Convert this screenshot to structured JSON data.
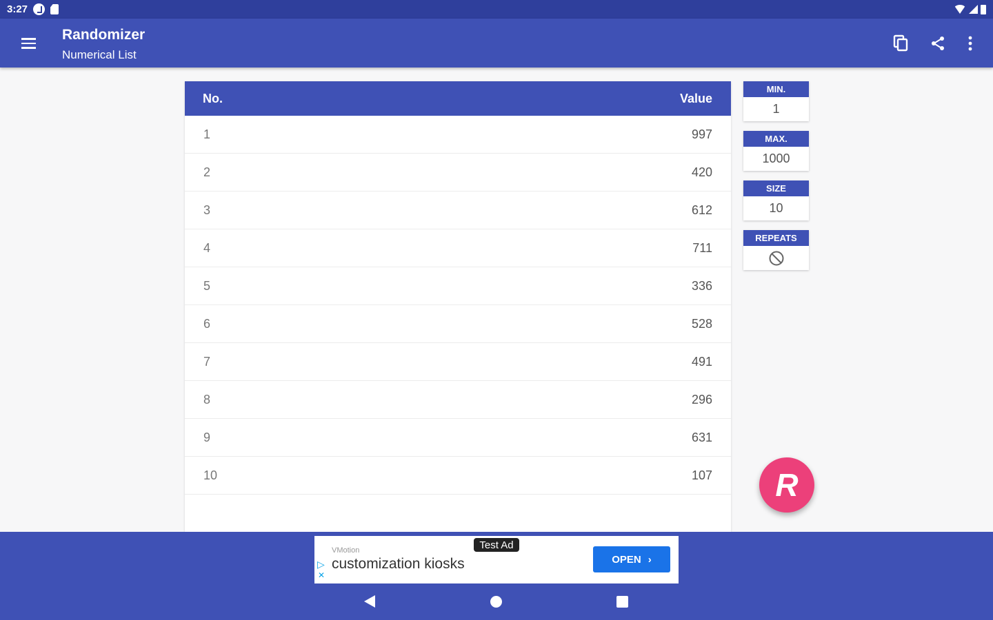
{
  "status_bar": {
    "time": "3:27"
  },
  "app_bar": {
    "title": "Randomizer",
    "subtitle": "Numerical List",
    "actions": [
      "copy-icon",
      "share-icon",
      "more-vert-icon"
    ]
  },
  "table": {
    "header": {
      "no": "No.",
      "value": "Value"
    },
    "rows": [
      {
        "no": "1",
        "value": "997"
      },
      {
        "no": "2",
        "value": "420"
      },
      {
        "no": "3",
        "value": "612"
      },
      {
        "no": "4",
        "value": "711"
      },
      {
        "no": "5",
        "value": "336"
      },
      {
        "no": "6",
        "value": "528"
      },
      {
        "no": "7",
        "value": "491"
      },
      {
        "no": "8",
        "value": "296"
      },
      {
        "no": "9",
        "value": "631"
      },
      {
        "no": "10",
        "value": "107"
      }
    ]
  },
  "settings": {
    "min": {
      "label": "MIN.",
      "value": "1"
    },
    "max": {
      "label": "MAX.",
      "value": "1000"
    },
    "size": {
      "label": "SIZE",
      "value": "10"
    },
    "repeats": {
      "label": "REPEATS",
      "icon": "block-icon"
    }
  },
  "fab": {
    "label": "R"
  },
  "ad": {
    "advertiser": "VMotion",
    "headline": "customization kiosks",
    "badge": "Test Ad",
    "cta": "OPEN",
    "cta_icon": "›",
    "choices_play": "▷",
    "choices_close": "✕"
  },
  "colors": {
    "primary": "#3f51b5",
    "status_bar": "#2f3f9c",
    "accent": "#ec407a",
    "ad_button": "#1a73e8"
  }
}
